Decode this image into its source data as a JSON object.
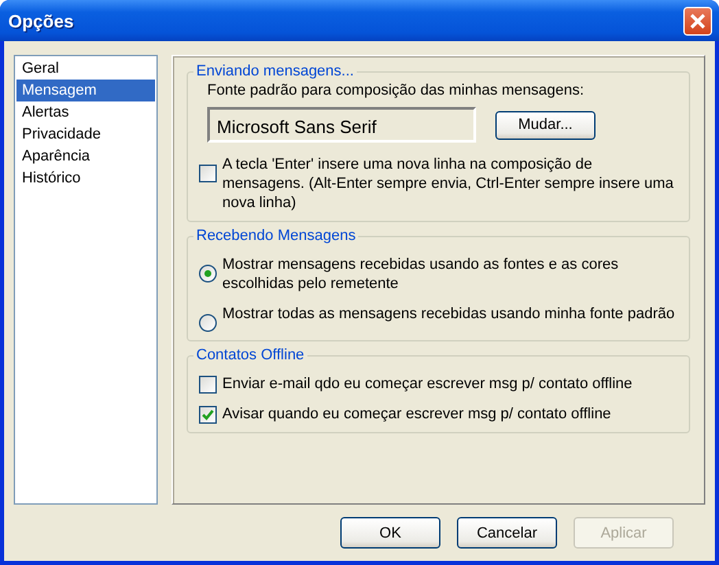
{
  "window": {
    "title": "Opções"
  },
  "sidebar": {
    "items": [
      {
        "label": "Geral",
        "selected": false
      },
      {
        "label": "Mensagem",
        "selected": true
      },
      {
        "label": "Alertas",
        "selected": false
      },
      {
        "label": "Privacidade",
        "selected": false
      },
      {
        "label": "Aparência",
        "selected": false
      },
      {
        "label": "Histórico",
        "selected": false
      }
    ]
  },
  "sending": {
    "legend": "Enviando mensagens...",
    "font_label": "Fonte padrão para composição das minhas mensagens:",
    "font_value": "Microsoft Sans Serif",
    "change_button": "Mudar...",
    "enter_option": {
      "label": "A tecla 'Enter' insere uma nova linha na composição de mensagens. (Alt-Enter sempre envia, Ctrl-Enter sempre insere uma nova linha)",
      "checked": false
    }
  },
  "receiving": {
    "legend": "Recebendo Mensagens",
    "options": [
      {
        "label": "Mostrar mensagens recebidas usando as fontes e as cores escolhidas pelo remetente",
        "selected": true
      },
      {
        "label": "Mostrar todas as mensagens recebidas usando minha fonte padrão",
        "selected": false
      }
    ]
  },
  "offline": {
    "legend": "Contatos Offline",
    "options": [
      {
        "label": "Enviar e-mail qdo eu começar escrever msg p/ contato offline",
        "checked": false
      },
      {
        "label": "Avisar quando eu começar escrever msg p/ contato offline",
        "checked": true
      }
    ]
  },
  "buttons": [
    {
      "label": "OK",
      "disabled": false
    },
    {
      "label": "Cancelar",
      "disabled": false
    },
    {
      "label": "Aplicar",
      "disabled": true
    }
  ]
}
